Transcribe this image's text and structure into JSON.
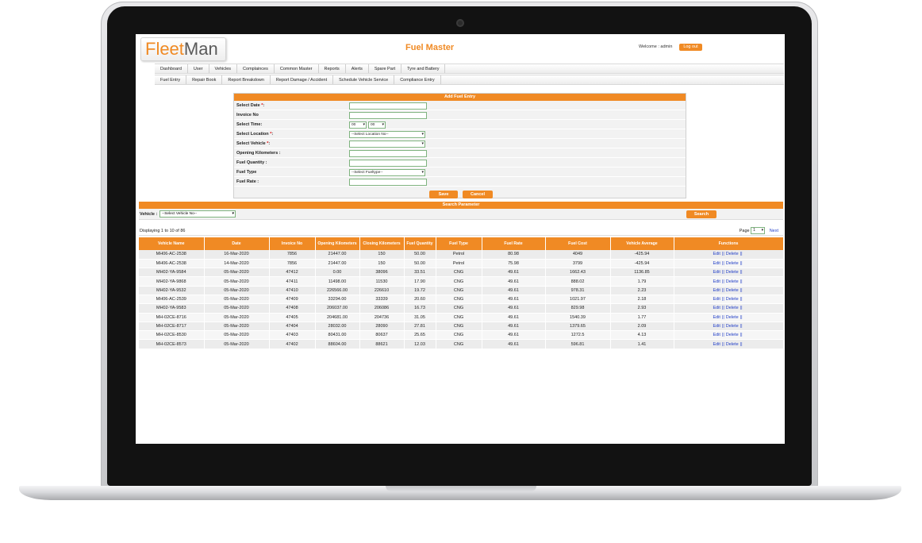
{
  "app": {
    "logo_fleet": "Fleet",
    "logo_man": "Man",
    "title": "Fuel Master"
  },
  "header": {
    "welcome": "Welcome : admin",
    "logout_label": "Log out"
  },
  "menu": {
    "row1": [
      "Dashboard",
      "User",
      "Vehicles",
      "Complainces",
      "Common Master",
      "Reports",
      "Alerts",
      "Spare Part",
      "Tyre and Battery"
    ],
    "row2": [
      "Fuel Entry",
      "Repair Book",
      "Report Breakdown",
      "Report Damage / Accident",
      "Schedule Vehicle Service",
      "Compliance Entry"
    ]
  },
  "form": {
    "title": "Add Fuel Entry",
    "fields": {
      "date": "Select Date",
      "invoice": "Invoice No",
      "time": "Select Time:",
      "location": "Select Location",
      "vehicle": "Select Vehicle",
      "opening_km": "Opening Kilometers :",
      "fuel_qty": "Fuel Quantity :",
      "fuel_type": "Fuel Type",
      "fuel_rate": "Fuel Rate :"
    },
    "required_mark": "*",
    "colon": ":",
    "time_hour": "00",
    "time_min": "00",
    "location_placeholder": "--Select Location No--",
    "fueltype_placeholder": "--Select Fueltype--",
    "save_label": "Save",
    "cancel_label": "Cancel"
  },
  "search": {
    "title": "Search Parameter",
    "vehicle_label": "Vehicle :",
    "vehicle_placeholder": "--Select Vehicle No--",
    "button_label": "Search"
  },
  "listing": {
    "info": "Displaying 1 to 10 of 86",
    "page_label": "Page",
    "page_value": "1",
    "next_label": "Next"
  },
  "table": {
    "headers": [
      "Vehicle Name",
      "Date",
      "Invoice No",
      "Opening Kilometers",
      "Closing Kilometers",
      "Fuel Quantity",
      "Fuel Type",
      "Fuel Rate",
      "Fuel Cost",
      "Vehicle Average",
      "Functions"
    ],
    "edit_label": "Edit",
    "delete_label": "Delete",
    "separator": "||",
    "rows": [
      [
        "MH06-AC-2538",
        "16-Mar-2020",
        "7856",
        "21447.00",
        "150",
        "50.00",
        "Petrol",
        "80.98",
        "4049",
        "-425.94"
      ],
      [
        "MH06-AC-2538",
        "14-Mar-2020",
        "7856",
        "21447.00",
        "150",
        "50.00",
        "Petrol",
        "75.98",
        "3799",
        "-425.94"
      ],
      [
        "MH02-YA-9584",
        "05-Mar-2020",
        "47412",
        "0.00",
        "38096",
        "33.51",
        "CNG",
        "49.61",
        "1662.43",
        "1136.85"
      ],
      [
        "MH02-YA-9868",
        "05-Mar-2020",
        "47411",
        "11498.00",
        "11530",
        "17.90",
        "CNG",
        "49.61",
        "888.02",
        "1.79"
      ],
      [
        "MH02-YA-9532",
        "05-Mar-2020",
        "47410",
        "226566.00",
        "226610",
        "19.72",
        "CNG",
        "49.61",
        "978.31",
        "2.23"
      ],
      [
        "MH06-AC-2539",
        "05-Mar-2020",
        "47409",
        "33294.00",
        "33339",
        "20.60",
        "CNG",
        "49.61",
        "1021.97",
        "2.18"
      ],
      [
        "MH02-YA-9583",
        "05-Mar-2020",
        "47408",
        "206037.00",
        "206086",
        "16.73",
        "CNG",
        "49.61",
        "829.98",
        "2.93"
      ],
      [
        "MH-02CE-8716",
        "05-Mar-2020",
        "47405",
        "204681.00",
        "204736",
        "31.05",
        "CNG",
        "49.61",
        "1540.39",
        "1.77"
      ],
      [
        "MH-02CE-8717",
        "05-Mar-2020",
        "47404",
        "28032.00",
        "28090",
        "27.81",
        "CNG",
        "49.61",
        "1379.65",
        "2.09"
      ],
      [
        "MH-02CE-8530",
        "05-Mar-2020",
        "47403",
        "80431.00",
        "80637",
        "25.65",
        "CNG",
        "49.61",
        "1272.5",
        "4.13"
      ],
      [
        "MH-02CE-8573",
        "05-Mar-2020",
        "47402",
        "88604.00",
        "88621",
        "12.03",
        "CNG",
        "49.61",
        "596.81",
        "1.41"
      ]
    ]
  },
  "colors": {
    "accent": "#f08a24",
    "link": "#2340c8"
  }
}
